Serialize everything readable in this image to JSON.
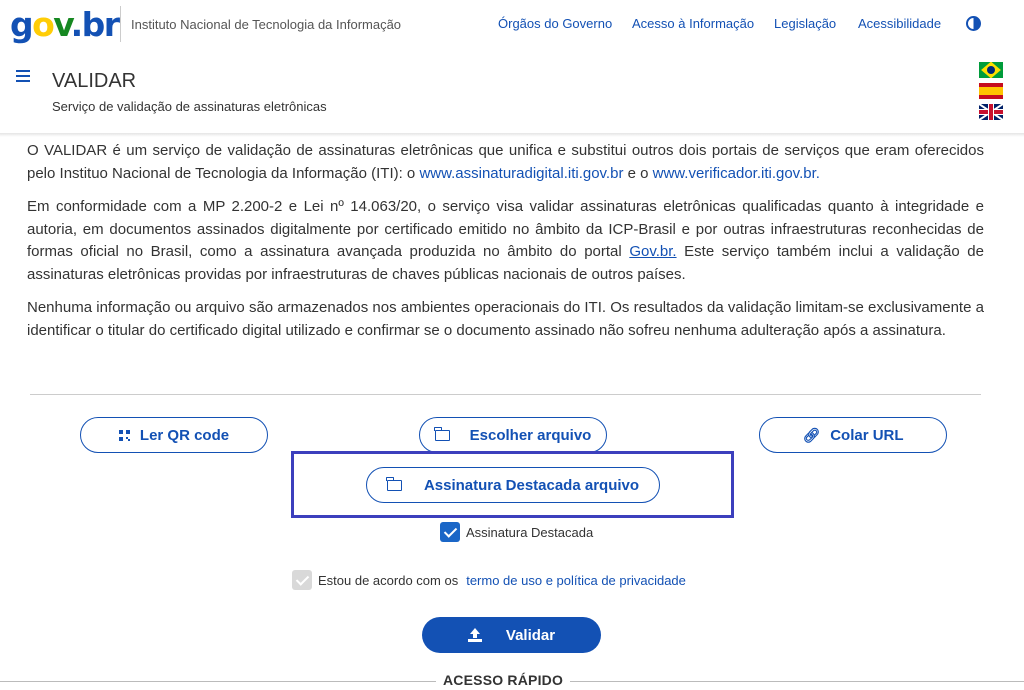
{
  "header": {
    "logo_parts": [
      "g",
      "o",
      "v",
      ".",
      "br"
    ],
    "institute": "Instituto Nacional de Tecnologia da Informação",
    "links": [
      "Órgãos do Governo",
      "Acesso à Informação",
      "Legislação",
      "Acessibilidade"
    ],
    "contrast_icon": "contrast-icon"
  },
  "page": {
    "title": "VALIDAR",
    "subtitle": "Serviço de validação de assinaturas eletrônicas",
    "languages": [
      "flag-brazil",
      "flag-spain",
      "flag-uk"
    ]
  },
  "content": {
    "p1_text": "O VALIDAR é um serviço de validação de assinaturas eletrônicas que unifica e substitui outros dois portais de serviços que eram oferecidos pelo Instituo Nacional de Tecnologia da Informação (ITI): o ",
    "p1_link1": "www.assinaturadigital.iti.gov.br",
    "p1_mid": " e o ",
    "p1_link2": "www.verificador.iti.gov.br.",
    "p2_text": "Em conformidade com a MP 2.200-2 e Lei nº 14.063/20, o serviço visa validar assinaturas eletrônicas qualificadas quanto à integridade e autoria, em documentos assinados digitalmente por certificado emitido no âmbito da ICP-Brasil e por outras infraestruturas reconhecidas de formas oficial no Brasil, como a assinatura avançada produzida no âmbito do portal ",
    "p2_link": "Gov.br.",
    "p2_end": " Este serviço também inclui a validação de assinaturas eletrônicas providas por infraestruturas de chaves públicas nacionais de outros países.",
    "p3_text": "Nenhuma informação ou arquivo são armazenados nos ambientes operacionais do ITI. Os resultados da validação limitam-se exclusivamente a identificar o titular do certificado digital utilizado e confirmar se o documento assinado não sofreu nenhuma adulteração após a assinatura."
  },
  "actions": {
    "qr_label": "Ler QR code",
    "file_label": "Escolher arquivo",
    "url_label": "Colar URL",
    "detached_label": "Assinatura Destacada arquivo",
    "detached_check_label": "Assinatura Destacada",
    "detached_checked": true,
    "terms_prefix": "Estou de acordo com os",
    "terms_link": "termo de uso e política de privacidade",
    "terms_checked": true,
    "validate_label": "Validar"
  },
  "footer": {
    "quick_access": "ACESSO RÁPIDO"
  },
  "colors": {
    "primary": "#1351b4",
    "highlight": "#3c3fbd"
  }
}
